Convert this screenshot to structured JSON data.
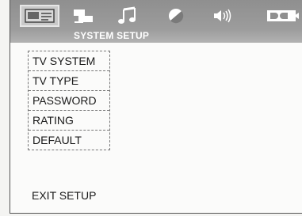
{
  "header": {
    "title": "SYSTEM SETUP",
    "tabs": [
      {
        "icon": "system-setup-icon",
        "selected": true
      },
      {
        "icon": "language-setup-icon",
        "selected": false
      },
      {
        "icon": "audio-setup-icon",
        "selected": false
      },
      {
        "icon": "video-setup-icon",
        "selected": false
      },
      {
        "icon": "speaker-setup-icon",
        "selected": false
      },
      {
        "icon": "dolby-digital-icon",
        "selected": false
      }
    ]
  },
  "menu": {
    "items": [
      {
        "label": "TV SYSTEM"
      },
      {
        "label": "TV TYPE"
      },
      {
        "label": "PASSWORD"
      },
      {
        "label": "RATING"
      },
      {
        "label": "DEFAULT"
      }
    ]
  },
  "footer": {
    "exit_label": "EXIT SETUP"
  },
  "colors": {
    "bar": "#9a9a9a",
    "title_text": "#ffffff",
    "text": "#1a1a1a"
  }
}
